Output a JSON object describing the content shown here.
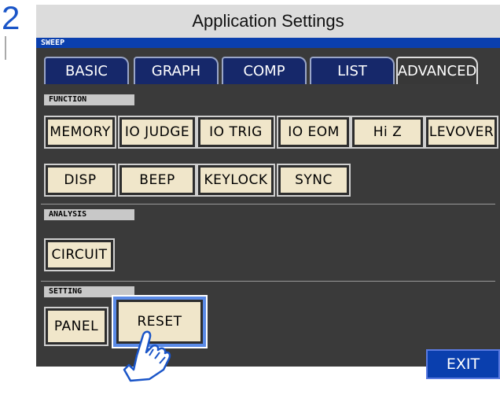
{
  "step_number": "2",
  "window": {
    "title": "Application Settings",
    "mode": "SWEEP"
  },
  "tabs": [
    {
      "label": "BASIC",
      "active": false
    },
    {
      "label": "GRAPH",
      "active": false
    },
    {
      "label": "COMP",
      "active": false
    },
    {
      "label": "LIST",
      "active": false
    },
    {
      "label": "ADVANCED",
      "active": true
    }
  ],
  "sections": {
    "function": {
      "label": "FUNCTION",
      "buttons": [
        "MEMORY",
        "IO JUDGE",
        "IO TRIG",
        "IO EOM",
        "Hi Z",
        "LEVOVER",
        "DISP",
        "BEEP",
        "KEYLOCK",
        "SYNC"
      ]
    },
    "analysis": {
      "label": "ANALYSIS",
      "buttons": [
        "CIRCUIT"
      ]
    },
    "setting": {
      "label": "SETTING",
      "buttons": [
        "PANEL",
        "RESET"
      ]
    }
  },
  "exit_label": "EXIT",
  "colors": {
    "panel_bg": "#3a3a3a",
    "button_bg": "#f0e6ca",
    "tab_bg": "#16286a",
    "accent_blue": "#0a3fae",
    "step_number": "#1a55c8"
  },
  "pointer": {
    "icon": "pointing-hand-icon",
    "target": "RESET"
  }
}
